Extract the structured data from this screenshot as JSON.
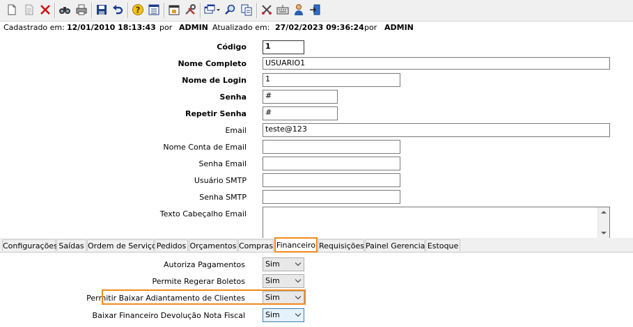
{
  "toolbar": {
    "icons": [
      "new-document",
      "edit-document",
      "delete",
      "find",
      "print",
      "save",
      "undo",
      "help",
      "list",
      "calendar-report",
      "tools",
      "windows-menu",
      "search",
      "copy",
      "cut-tools",
      "keyboard",
      "user",
      "exit"
    ]
  },
  "meta": {
    "created_label": "Cadastrado em:",
    "created_value": "12/01/2010 18:13:43",
    "created_by_label": "por",
    "created_by_value": "ADMIN",
    "updated_label": "Atualizado em:",
    "updated_value": "27/02/2023 09:36:24",
    "updated_by_label": "por",
    "updated_by_value": "ADMIN"
  },
  "form": {
    "codigo_label": "Código",
    "codigo_value": "1",
    "nome_completo_label": "Nome Completo",
    "nome_completo_value": "USUARIO1",
    "nome_login_label": "Nome de Login",
    "nome_login_value": "1",
    "senha_label": "Senha",
    "senha_value": "#",
    "repetir_senha_label": "Repetir Senha",
    "repetir_senha_value": "#",
    "email_label": "Email",
    "email_value": "teste@123",
    "nome_conta_email_label": "Nome Conta de Email",
    "nome_conta_email_value": "",
    "senha_email_label": "Senha Email",
    "senha_email_value": "",
    "usuario_smtp_label": "Usuário SMTP",
    "usuario_smtp_value": "",
    "senha_smtp_label": "Senha SMTP",
    "senha_smtp_value": "",
    "texto_cabecalho_label": "Texto Cabeçalho Email",
    "texto_cabecalho_value": ""
  },
  "tabs": [
    {
      "label": "Configurações"
    },
    {
      "label": "Saídas"
    },
    {
      "label": "Ordem de Serviço"
    },
    {
      "label": "Pedidos"
    },
    {
      "label": "Orçamentos"
    },
    {
      "label": "Compras"
    },
    {
      "label": "Financeiro",
      "active": true
    },
    {
      "label": "Requisições"
    },
    {
      "label": "Painel Gerencial"
    },
    {
      "label": "Estoque"
    }
  ],
  "financeiro": {
    "fields": [
      {
        "label": "Autoriza Pagamentos",
        "value": "Sim"
      },
      {
        "label": "Permite Regerar Boletos",
        "value": "Sim"
      },
      {
        "label": "Permitir Baixar Adiantamento de Clientes",
        "value": "Sim"
      },
      {
        "label": "Baixar Financeiro Devolução Nota Fiscal",
        "value": "Sim"
      }
    ]
  },
  "colors": {
    "highlight": "#f08a1a",
    "toolbar_bg": "#f0f0f0"
  }
}
